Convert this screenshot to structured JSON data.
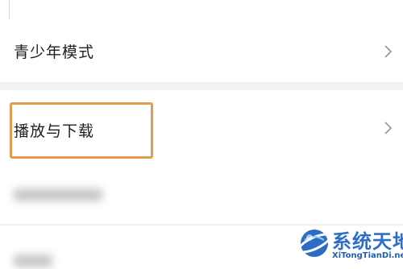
{
  "settings": {
    "rows": [
      {
        "label": "青少年模式",
        "has_chevron": true,
        "icon": "chevron-right-icon"
      },
      {
        "label": "播放与下载",
        "has_chevron": true,
        "icon": "chevron-right-icon",
        "highlighted": true
      },
      {
        "label": "",
        "blurred": true
      },
      {
        "label": "",
        "blurred": true
      }
    ]
  },
  "highlight_color": "#e59a4d",
  "watermark": {
    "title": "系统天地",
    "url": "XiTongTianDi.net"
  }
}
